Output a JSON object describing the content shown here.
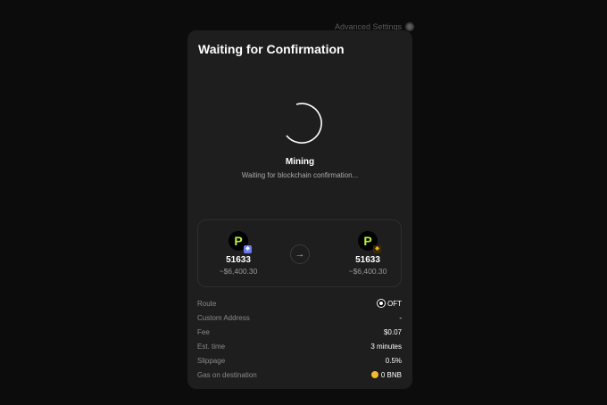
{
  "header": {
    "advanced_settings": "Advanced Settings"
  },
  "modal": {
    "title": "Waiting for Confirmation",
    "status": "Mining",
    "status_sub": "Waiting for blockchain confirmation..."
  },
  "swap": {
    "from": {
      "logo": "P",
      "amount": "51633",
      "usd": "~$6,400.30",
      "chain_color": "#6c7cf0"
    },
    "to": {
      "logo": "P",
      "amount": "51633",
      "usd": "~$6,400.30",
      "chain_color": "#f0b90b"
    }
  },
  "details": [
    {
      "label": "Route",
      "value": "OFT",
      "icon": "route-icon"
    },
    {
      "label": "Custom Address",
      "value": "-"
    },
    {
      "label": "Fee",
      "value": "$0.07"
    },
    {
      "label": "Est. time",
      "value": "3 minutes"
    },
    {
      "label": "Slippage",
      "value": "0.5%"
    },
    {
      "label": "Gas on destination",
      "value": "0 BNB",
      "icon": "bnb-coin-icon"
    }
  ]
}
